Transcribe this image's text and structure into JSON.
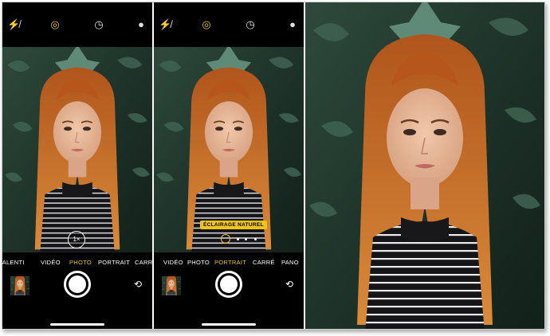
{
  "screens": [
    {
      "modes": [
        "RALENTI",
        "VIDÉO",
        "PHOTO",
        "PORTRAIT",
        "CARRÉ"
      ],
      "active_mode": "PHOTO",
      "zoom_label": "1×",
      "top_icons": [
        "flash-off-icon",
        "live-photo-icon",
        "timer-icon",
        "filters-icon"
      ]
    },
    {
      "modes": [
        "VIDÉO",
        "PHOTO",
        "PORTRAIT",
        "CARRÉ",
        "PANO"
      ],
      "active_mode": "PORTRAIT",
      "lighting_badge": "ÉCLAIRAGE NATUREL",
      "top_icons": [
        "flash-off-icon",
        "live-photo-icon",
        "timer-icon",
        "filters-icon"
      ]
    }
  ],
  "colors": {
    "accent": "#f0c419",
    "background": "#000000"
  }
}
